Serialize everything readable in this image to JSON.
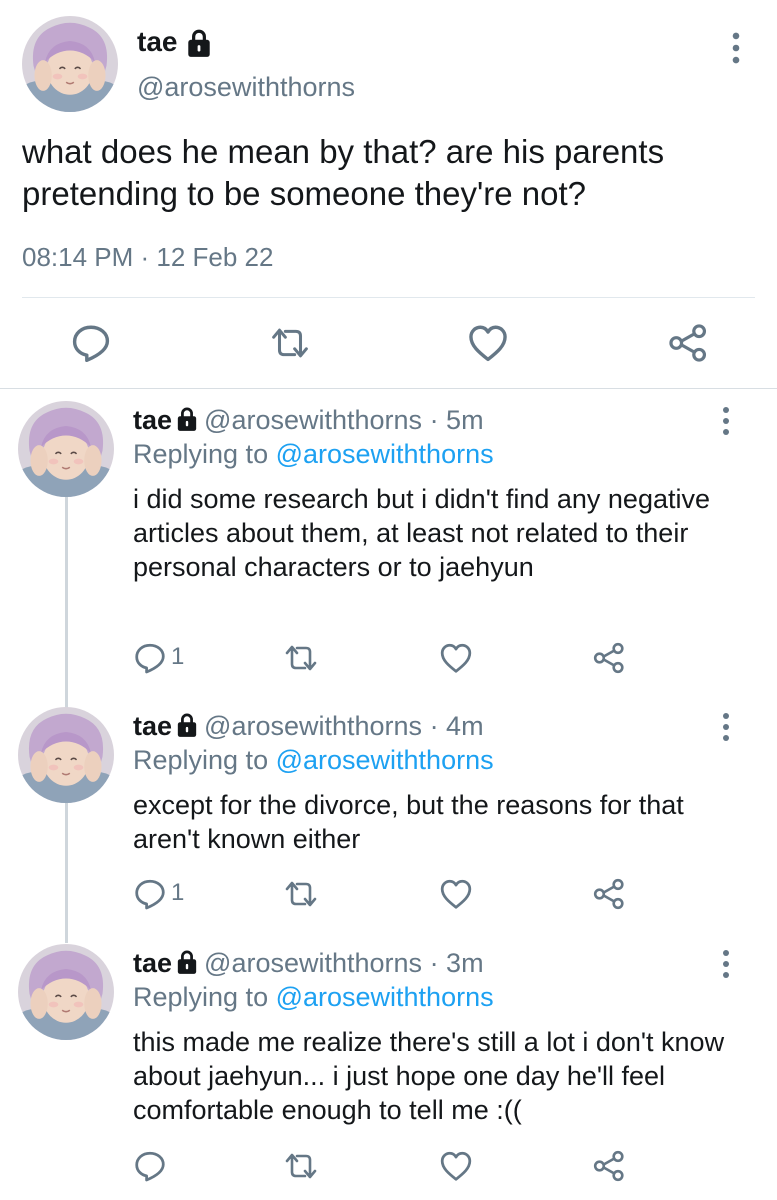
{
  "main_tweet": {
    "name": "tae",
    "handle": "@arosewiththorns",
    "text": "what does he mean by that? are his parents pretending to be someone they're not?",
    "time": "08:14 PM · 12 Feb 22"
  },
  "replies": [
    {
      "name": "tae",
      "handle": "@arosewiththorns",
      "time_ago": "· 5m",
      "replying_prefix": "Replying to ",
      "replying_to": "@arosewiththorns",
      "text": "i did some research but i didn't find any negative articles about them, at least not related to their personal characters or to jaehyun",
      "reply_count": "1"
    },
    {
      "name": "tae",
      "handle": "@arosewiththorns",
      "time_ago": "· 4m",
      "replying_prefix": "Replying to ",
      "replying_to": "@arosewiththorns",
      "text": "except for the divorce, but the reasons for that aren't known either",
      "reply_count": "1"
    },
    {
      "name": "tae",
      "handle": "@arosewiththorns",
      "time_ago": "· 3m",
      "replying_prefix": "Replying to ",
      "replying_to": "@arosewiththorns",
      "text": "this made me realize there's still a lot i don't know about jaehyun... i just hope one day he'll feel comfortable enough to tell me :((",
      "reply_count": ""
    }
  ],
  "icons": {
    "lock": "lock-icon",
    "more": "more-vertical-icon",
    "reply": "reply-icon",
    "retweet": "retweet-icon",
    "like": "heart-icon",
    "share": "share-icon"
  },
  "colors": {
    "text": "#14171a",
    "secondary": "#657786",
    "link": "#1da1f2",
    "divider": "#e1e8ed"
  }
}
